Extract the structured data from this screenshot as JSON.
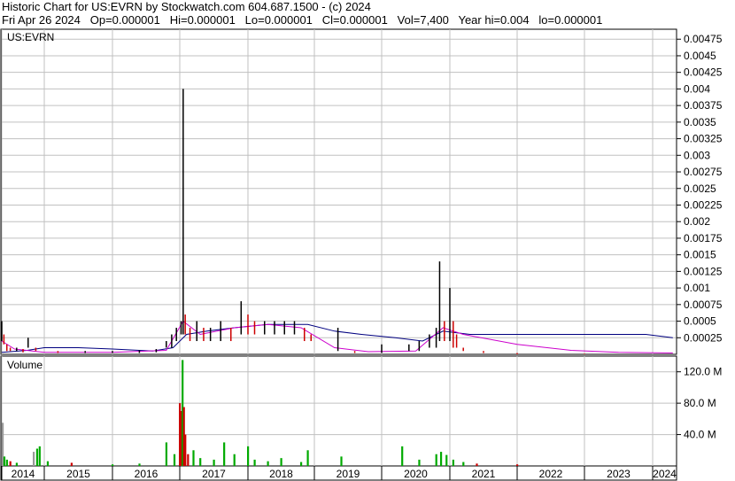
{
  "header": {
    "line1": "Historic Chart for US:EVRN by Stockwatch.com 604.687.1500 - (c) 2024",
    "line2": "Fri Apr 26 2024   Op=0.000001   Hi=0.000001   Lo=0.000001   Cl=0.000001   Vol=7,400   Year hi=0.004   lo=0.000001"
  },
  "colors": {
    "price_bar": "#000000",
    "price_bar_down": "#cc0000",
    "ma_long": "#000080",
    "ma_short": "#cc00cc",
    "volume_up": "#00aa00",
    "volume_down": "#cc0000",
    "volume_flat": "#999999",
    "grid": "#c0c0c0"
  },
  "chart_data": [
    {
      "type": "line",
      "title": "US:EVRN",
      "ylim": [
        0,
        0.0049
      ],
      "yticks": [
        "0.00475",
        "0.0045",
        "0.00425",
        "0.004",
        "0.00375",
        "0.0035",
        "0.00325",
        "0.003",
        "0.00275",
        "0.0025",
        "0.00225",
        "0.002",
        "0.00175",
        "0.0015",
        "0.00125",
        "0.001",
        "0.00075",
        "0.0005",
        "0.00025"
      ],
      "ytick_values": [
        0.00475,
        0.0045,
        0.00425,
        0.004,
        0.00375,
        0.0035,
        0.00325,
        0.003,
        0.00275,
        0.0025,
        0.00225,
        0.002,
        0.00175,
        0.0015,
        0.00125,
        0.001,
        0.00075,
        0.0005,
        0.00025
      ],
      "x_categories": [
        "2014",
        "2015",
        "2016",
        "2017",
        "2018",
        "2019",
        "2020",
        "2021",
        "2022",
        "2023",
        "2024"
      ],
      "grid": true,
      "series": [
        {
          "style": "hilo-bars",
          "points": [
            [
              2014.0,
              0.0002,
              0.0005
            ],
            [
              2014.05,
              0.00015,
              0.0003
            ],
            [
              2014.12,
              5e-05,
              0.00015
            ],
            [
              2014.2,
              5e-05,
              0.0001
            ],
            [
              2014.35,
              5e-05,
              0.0001
            ],
            [
              2014.5,
              3e-05,
              8e-05
            ],
            [
              2014.62,
              0.0001,
              0.00025
            ],
            [
              2014.8,
              5e-05,
              0.0001
            ],
            [
              2015.2,
              2e-05,
              5e-05
            ],
            [
              2015.6,
              2e-05,
              5e-05
            ],
            [
              2016.0,
              2e-05,
              5e-05
            ],
            [
              2016.4,
              2e-05,
              6e-05
            ],
            [
              2016.65,
              3e-05,
              8e-05
            ],
            [
              2016.8,
              0.0001,
              0.0002
            ],
            [
              2016.88,
              0.0001,
              0.0003
            ],
            [
              2016.95,
              0.0002,
              0.0004
            ],
            [
              2017.02,
              0.0003,
              0.0005
            ],
            [
              2017.05,
              0.0003,
              0.004
            ],
            [
              2017.08,
              0.0003,
              0.0006
            ],
            [
              2017.15,
              0.0002,
              0.0004
            ],
            [
              2017.25,
              0.0002,
              0.0005
            ],
            [
              2017.35,
              0.0002,
              0.0004
            ],
            [
              2017.45,
              0.0002,
              0.0004
            ],
            [
              2017.6,
              0.0002,
              0.0005
            ],
            [
              2017.75,
              0.0002,
              0.0004
            ],
            [
              2017.9,
              0.0003,
              0.0008
            ],
            [
              2018.0,
              0.0003,
              0.0006
            ],
            [
              2018.1,
              0.0003,
              0.0005
            ],
            [
              2018.25,
              0.0003,
              0.0005
            ],
            [
              2018.4,
              0.0003,
              0.0005
            ],
            [
              2018.55,
              0.0003,
              0.0005
            ],
            [
              2018.7,
              0.0003,
              0.0005
            ],
            [
              2018.85,
              0.0002,
              0.0004
            ],
            [
              2018.95,
              0.0002,
              0.0003
            ],
            [
              2019.35,
              5e-05,
              0.0004
            ],
            [
              2019.6,
              2e-05,
              5e-05
            ],
            [
              2020.0,
              2e-05,
              0.00015
            ],
            [
              2020.4,
              5e-05,
              0.00015
            ],
            [
              2020.55,
              5e-05,
              0.0002
            ],
            [
              2020.7,
              0.0001,
              0.0003
            ],
            [
              2020.8,
              0.0001,
              0.0004
            ],
            [
              2020.85,
              0.0002,
              0.0014
            ],
            [
              2020.92,
              0.0002,
              0.0005
            ],
            [
              2021.0,
              0.0002,
              0.001
            ],
            [
              2021.05,
              0.0001,
              0.0005
            ],
            [
              2021.1,
              0.0001,
              0.0003
            ],
            [
              2021.2,
              5e-05,
              0.0001
            ],
            [
              2021.5,
              2e-05,
              5e-05
            ],
            [
              2022.0,
              1e-06,
              2e-05
            ],
            [
              2023.0,
              1e-06,
              1e-05
            ],
            [
              2024.3,
              1e-06,
              1e-06
            ]
          ]
        },
        {
          "style": "moving-average-long",
          "points": [
            [
              2014.0,
              3e-05
            ],
            [
              2014.6,
              6e-05
            ],
            [
              2015.0,
              0.0001
            ],
            [
              2015.5,
              0.0001
            ],
            [
              2016.0,
              8e-05
            ],
            [
              2016.6,
              5e-05
            ],
            [
              2016.9,
              0.0001
            ],
            [
              2017.1,
              0.0003
            ],
            [
              2017.4,
              0.00035
            ],
            [
              2017.8,
              0.0004
            ],
            [
              2018.3,
              0.00045
            ],
            [
              2018.9,
              0.00045
            ],
            [
              2019.3,
              0.00035
            ],
            [
              2019.7,
              0.0003
            ],
            [
              2020.2,
              0.00025
            ],
            [
              2020.6,
              0.0002
            ],
            [
              2020.9,
              0.00035
            ],
            [
              2021.3,
              0.0003
            ],
            [
              2022.0,
              0.0003
            ],
            [
              2023.0,
              0.0003
            ],
            [
              2023.9,
              0.0003
            ],
            [
              2024.3,
              0.00025
            ]
          ]
        },
        {
          "style": "moving-average-short",
          "points": [
            [
              2014.0,
              0.0002
            ],
            [
              2014.3,
              8e-05
            ],
            [
              2015.0,
              3e-05
            ],
            [
              2016.0,
              3e-05
            ],
            [
              2016.8,
              6e-05
            ],
            [
              2017.05,
              0.0005
            ],
            [
              2017.3,
              0.0003
            ],
            [
              2017.8,
              0.0004
            ],
            [
              2018.3,
              0.00045
            ],
            [
              2018.8,
              0.0004
            ],
            [
              2019.3,
              0.0001
            ],
            [
              2019.8,
              4e-05
            ],
            [
              2020.5,
              5e-05
            ],
            [
              2020.9,
              0.0004
            ],
            [
              2021.2,
              0.0003
            ],
            [
              2022.0,
              0.00015
            ],
            [
              2022.8,
              6e-05
            ],
            [
              2023.5,
              3e-05
            ],
            [
              2024.3,
              2e-05
            ]
          ]
        }
      ]
    },
    {
      "type": "bar",
      "title": "Volume",
      "ylim": [
        0,
        140
      ],
      "yticks": [
        "120.0 M",
        "80.0 M",
        "40.0 M"
      ],
      "ytick_values": [
        120,
        80,
        40
      ],
      "unit": "M",
      "bars": [
        [
          2014.02,
          55,
          "flat"
        ],
        [
          2014.06,
          12,
          "up"
        ],
        [
          2014.12,
          8,
          "up"
        ],
        [
          2014.2,
          6,
          "down"
        ],
        [
          2014.35,
          4,
          "up"
        ],
        [
          2014.75,
          18,
          "flat"
        ],
        [
          2014.83,
          22,
          "up"
        ],
        [
          2014.89,
          25,
          "up"
        ],
        [
          2015.05,
          6,
          "up"
        ],
        [
          2015.4,
          4,
          "down"
        ],
        [
          2016.0,
          2,
          "up"
        ],
        [
          2016.4,
          3,
          "up"
        ],
        [
          2016.8,
          30,
          "up"
        ],
        [
          2016.92,
          15,
          "up"
        ],
        [
          2017.0,
          80,
          "down"
        ],
        [
          2017.02,
          70,
          "down"
        ],
        [
          2017.04,
          135,
          "up"
        ],
        [
          2017.06,
          75,
          "down"
        ],
        [
          2017.08,
          40,
          "down"
        ],
        [
          2017.12,
          15,
          "down"
        ],
        [
          2017.2,
          20,
          "up"
        ],
        [
          2017.3,
          10,
          "up"
        ],
        [
          2017.5,
          8,
          "up"
        ],
        [
          2017.65,
          30,
          "up"
        ],
        [
          2017.8,
          15,
          "up"
        ],
        [
          2018.0,
          25,
          "up"
        ],
        [
          2018.1,
          8,
          "up"
        ],
        [
          2018.3,
          6,
          "up"
        ],
        [
          2018.5,
          10,
          "up"
        ],
        [
          2018.8,
          5,
          "up"
        ],
        [
          2018.9,
          20,
          "up"
        ],
        [
          2019.4,
          12,
          "up"
        ],
        [
          2020.3,
          25,
          "up"
        ],
        [
          2020.55,
          8,
          "up"
        ],
        [
          2020.8,
          15,
          "up"
        ],
        [
          2020.87,
          18,
          "up"
        ],
        [
          2020.95,
          14,
          "up"
        ],
        [
          2021.05,
          8,
          "up"
        ],
        [
          2021.2,
          5,
          "up"
        ],
        [
          2021.4,
          3,
          "down"
        ],
        [
          2022.0,
          2,
          "down"
        ],
        [
          2023.0,
          1,
          "flat"
        ]
      ]
    }
  ]
}
